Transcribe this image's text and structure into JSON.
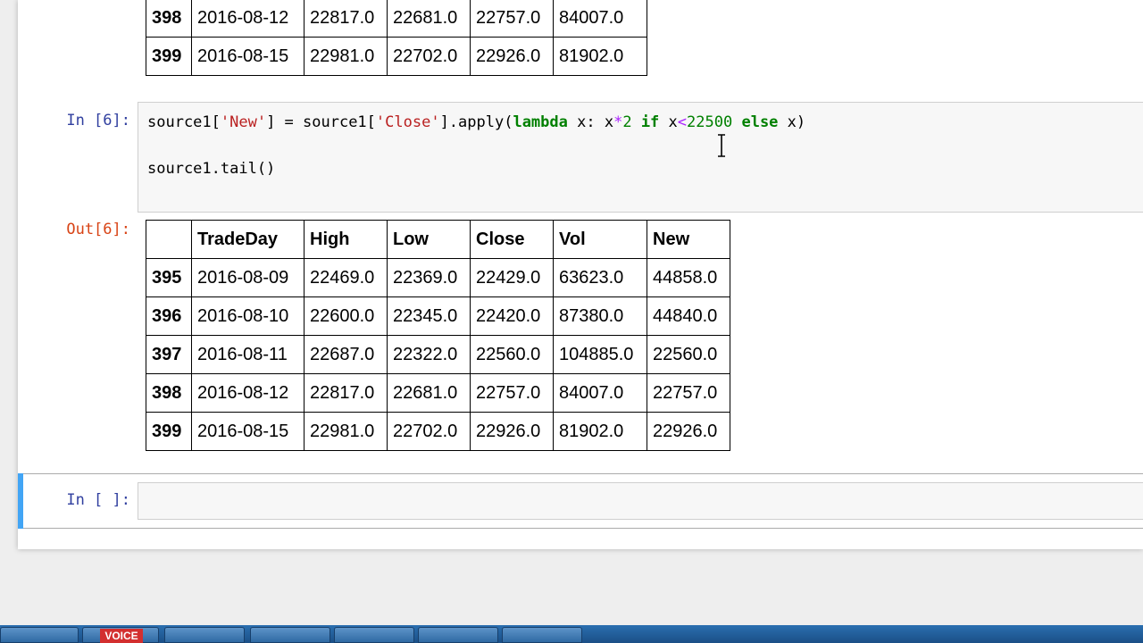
{
  "top_table": {
    "rows": [
      {
        "index": "398",
        "cells": [
          "2016-08-12",
          "22817.0",
          "22681.0",
          "22757.0",
          "84007.0"
        ]
      },
      {
        "index": "399",
        "cells": [
          "2016-08-15",
          "22981.0",
          "22702.0",
          "22926.0",
          "81902.0"
        ]
      }
    ]
  },
  "cell6": {
    "prompt": "In [6]:",
    "code_line1": {
      "a": "source1[",
      "b": "'New'",
      "c": "] = source1[",
      "d": "'Close'",
      "e": "].apply(",
      "f": "lambda",
      "g": " x: x",
      "h": "*",
      "i": "2",
      "j": " ",
      "k": "if",
      "l": " x",
      "m": "<",
      "n": "22500",
      "o": " ",
      "p": "else",
      "q": " x)"
    },
    "code_line2": "source1.tail()"
  },
  "out6": {
    "prompt": "Out[6]:",
    "headers": [
      "",
      "TradeDay",
      "High",
      "Low",
      "Close",
      "Vol",
      "New"
    ],
    "rows": [
      {
        "index": "395",
        "cells": [
          "2016-08-09",
          "22469.0",
          "22369.0",
          "22429.0",
          "63623.0",
          "44858.0"
        ]
      },
      {
        "index": "396",
        "cells": [
          "2016-08-10",
          "22600.0",
          "22345.0",
          "22420.0",
          "87380.0",
          "44840.0"
        ]
      },
      {
        "index": "397",
        "cells": [
          "2016-08-11",
          "22687.0",
          "22322.0",
          "22560.0",
          "104885.0",
          "22560.0"
        ]
      },
      {
        "index": "398",
        "cells": [
          "2016-08-12",
          "22817.0",
          "22681.0",
          "22757.0",
          "84007.0",
          "22757.0"
        ]
      },
      {
        "index": "399",
        "cells": [
          "2016-08-15",
          "22981.0",
          "22702.0",
          "22926.0",
          "81902.0",
          "22926.0"
        ]
      }
    ]
  },
  "empty_cell": {
    "prompt": "In [ ]:",
    "value": ""
  },
  "taskbar": {
    "voice_label": "VOICE"
  },
  "colors": {
    "in_prompt": "#303f9f",
    "out_prompt": "#d84315",
    "active_cell_bar": "#42a5f5"
  }
}
